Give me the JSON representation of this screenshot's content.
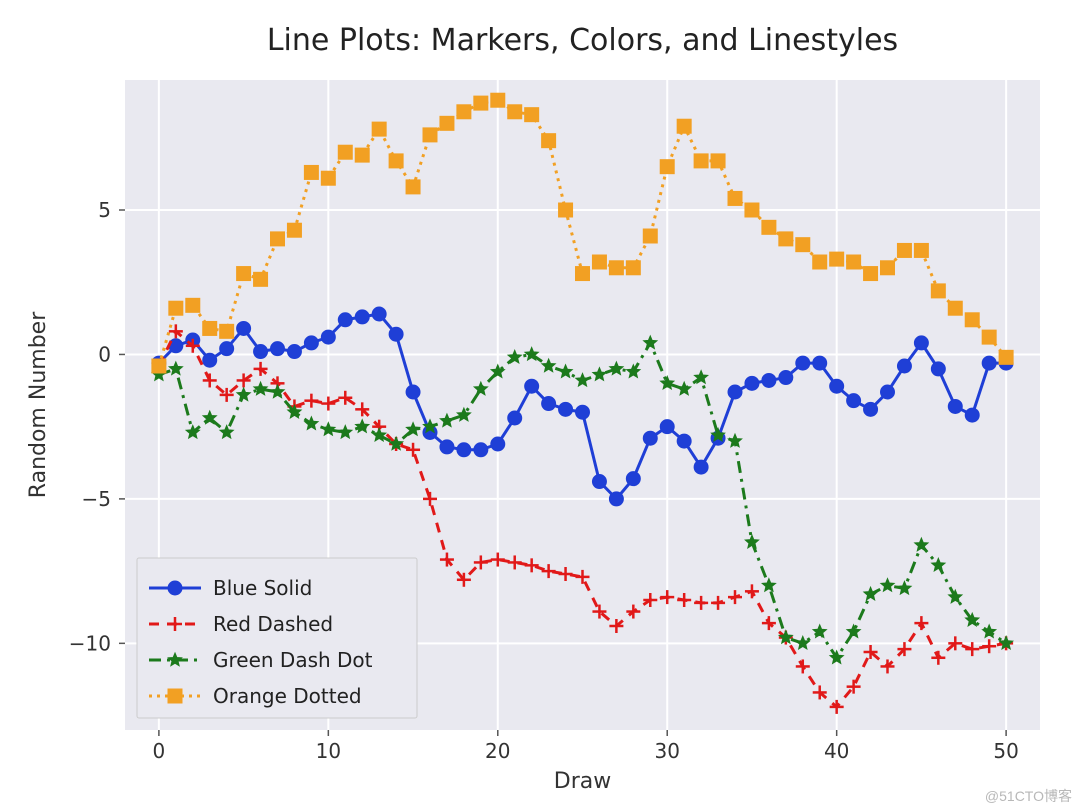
{
  "chart_data": {
    "type": "line",
    "title": "Line Plots: Markers, Colors, and Linestyles",
    "xlabel": "Draw",
    "ylabel": "Random Number",
    "xlim": [
      -2,
      52
    ],
    "ylim": [
      -13,
      9.5
    ],
    "x_ticks": [
      0,
      10,
      20,
      30,
      40,
      50
    ],
    "y_ticks": [
      -10,
      -5,
      0,
      5
    ],
    "x": [
      0,
      1,
      2,
      3,
      4,
      5,
      6,
      7,
      8,
      9,
      10,
      11,
      12,
      13,
      14,
      15,
      16,
      17,
      18,
      19,
      20,
      21,
      22,
      23,
      24,
      25,
      26,
      27,
      28,
      29,
      30,
      31,
      32,
      33,
      34,
      35,
      36,
      37,
      38,
      39,
      40,
      41,
      42,
      43,
      44,
      45,
      46,
      47,
      48,
      49,
      50
    ],
    "series": [
      {
        "name": "Blue Solid",
        "color": "#1f3fd6",
        "linestyle": "solid",
        "marker": "circle",
        "values": [
          -0.3,
          0.3,
          0.5,
          -0.2,
          0.2,
          0.9,
          0.1,
          0.2,
          0.1,
          0.4,
          0.6,
          1.2,
          1.3,
          1.4,
          0.7,
          -1.3,
          -2.7,
          -3.2,
          -3.3,
          -3.3,
          -3.1,
          -2.2,
          -1.1,
          -1.7,
          -1.9,
          -2.0,
          -4.4,
          -5.0,
          -4.3,
          -2.9,
          -2.5,
          -3.0,
          -3.9,
          -2.9,
          -1.3,
          -1.0,
          -0.9,
          -0.8,
          -0.3,
          -0.3,
          -1.1,
          -1.6,
          -1.9,
          -1.3,
          -0.4,
          0.4,
          -0.5,
          -1.8,
          -2.1,
          -0.3,
          -0.3
        ]
      },
      {
        "name": "Red Dashed",
        "color": "#e11919",
        "linestyle": "dashed",
        "marker": "plus",
        "values": [
          -0.4,
          0.8,
          0.3,
          -0.9,
          -1.4,
          -0.9,
          -0.5,
          -1.0,
          -1.8,
          -1.6,
          -1.7,
          -1.5,
          -1.9,
          -2.5,
          -3.1,
          -3.3,
          -5.0,
          -7.1,
          -7.8,
          -7.2,
          -7.1,
          -7.2,
          -7.3,
          -7.5,
          -7.6,
          -7.7,
          -8.9,
          -9.4,
          -8.9,
          -8.5,
          -8.4,
          -8.5,
          -8.6,
          -8.6,
          -8.4,
          -8.2,
          -9.3,
          -9.8,
          -10.8,
          -11.7,
          -12.2,
          -11.5,
          -10.3,
          -10.8,
          -10.2,
          -9.3,
          -10.5,
          -10.0,
          -10.2,
          -10.1,
          -10.0
        ]
      },
      {
        "name": "Green Dash Dot",
        "color": "#1c7a1c",
        "linestyle": "dashdot",
        "marker": "star",
        "values": [
          -0.7,
          -0.5,
          -2.7,
          -2.2,
          -2.7,
          -1.4,
          -1.2,
          -1.3,
          -2.0,
          -2.4,
          -2.6,
          -2.7,
          -2.5,
          -2.8,
          -3.1,
          -2.6,
          -2.5,
          -2.3,
          -2.1,
          -1.2,
          -0.6,
          -0.1,
          0.0,
          -0.4,
          -0.6,
          -0.9,
          -0.7,
          -0.5,
          -0.6,
          0.4,
          -1.0,
          -1.2,
          -0.8,
          -2.8,
          -3.0,
          -6.5,
          -8.0,
          -9.8,
          -10.0,
          -9.6,
          -10.5,
          -9.6,
          -8.3,
          -8.0,
          -8.1,
          -6.6,
          -7.3,
          -8.4,
          -9.2,
          -9.6,
          -10.0
        ]
      },
      {
        "name": "Orange Dotted",
        "color": "#f2a023",
        "linestyle": "dotted",
        "marker": "square",
        "values": [
          -0.4,
          1.6,
          1.7,
          0.9,
          0.8,
          2.8,
          2.6,
          4.0,
          4.3,
          6.3,
          6.1,
          7.0,
          6.9,
          7.8,
          6.7,
          5.8,
          7.6,
          8.0,
          8.4,
          8.7,
          8.8,
          8.4,
          8.3,
          7.4,
          5.0,
          2.8,
          3.2,
          3.0,
          3.0,
          4.1,
          6.5,
          7.9,
          6.7,
          6.7,
          5.4,
          5.0,
          4.4,
          4.0,
          3.8,
          3.2,
          3.3,
          3.2,
          2.8,
          3.0,
          3.6,
          3.6,
          2.2,
          1.6,
          1.2,
          0.6,
          -0.1
        ]
      }
    ],
    "legend": {
      "position": "lower left",
      "items": [
        "Blue Solid",
        "Red Dashed",
        "Green Dash Dot",
        "Orange Dotted"
      ]
    }
  },
  "watermark": "@51CTO博客"
}
